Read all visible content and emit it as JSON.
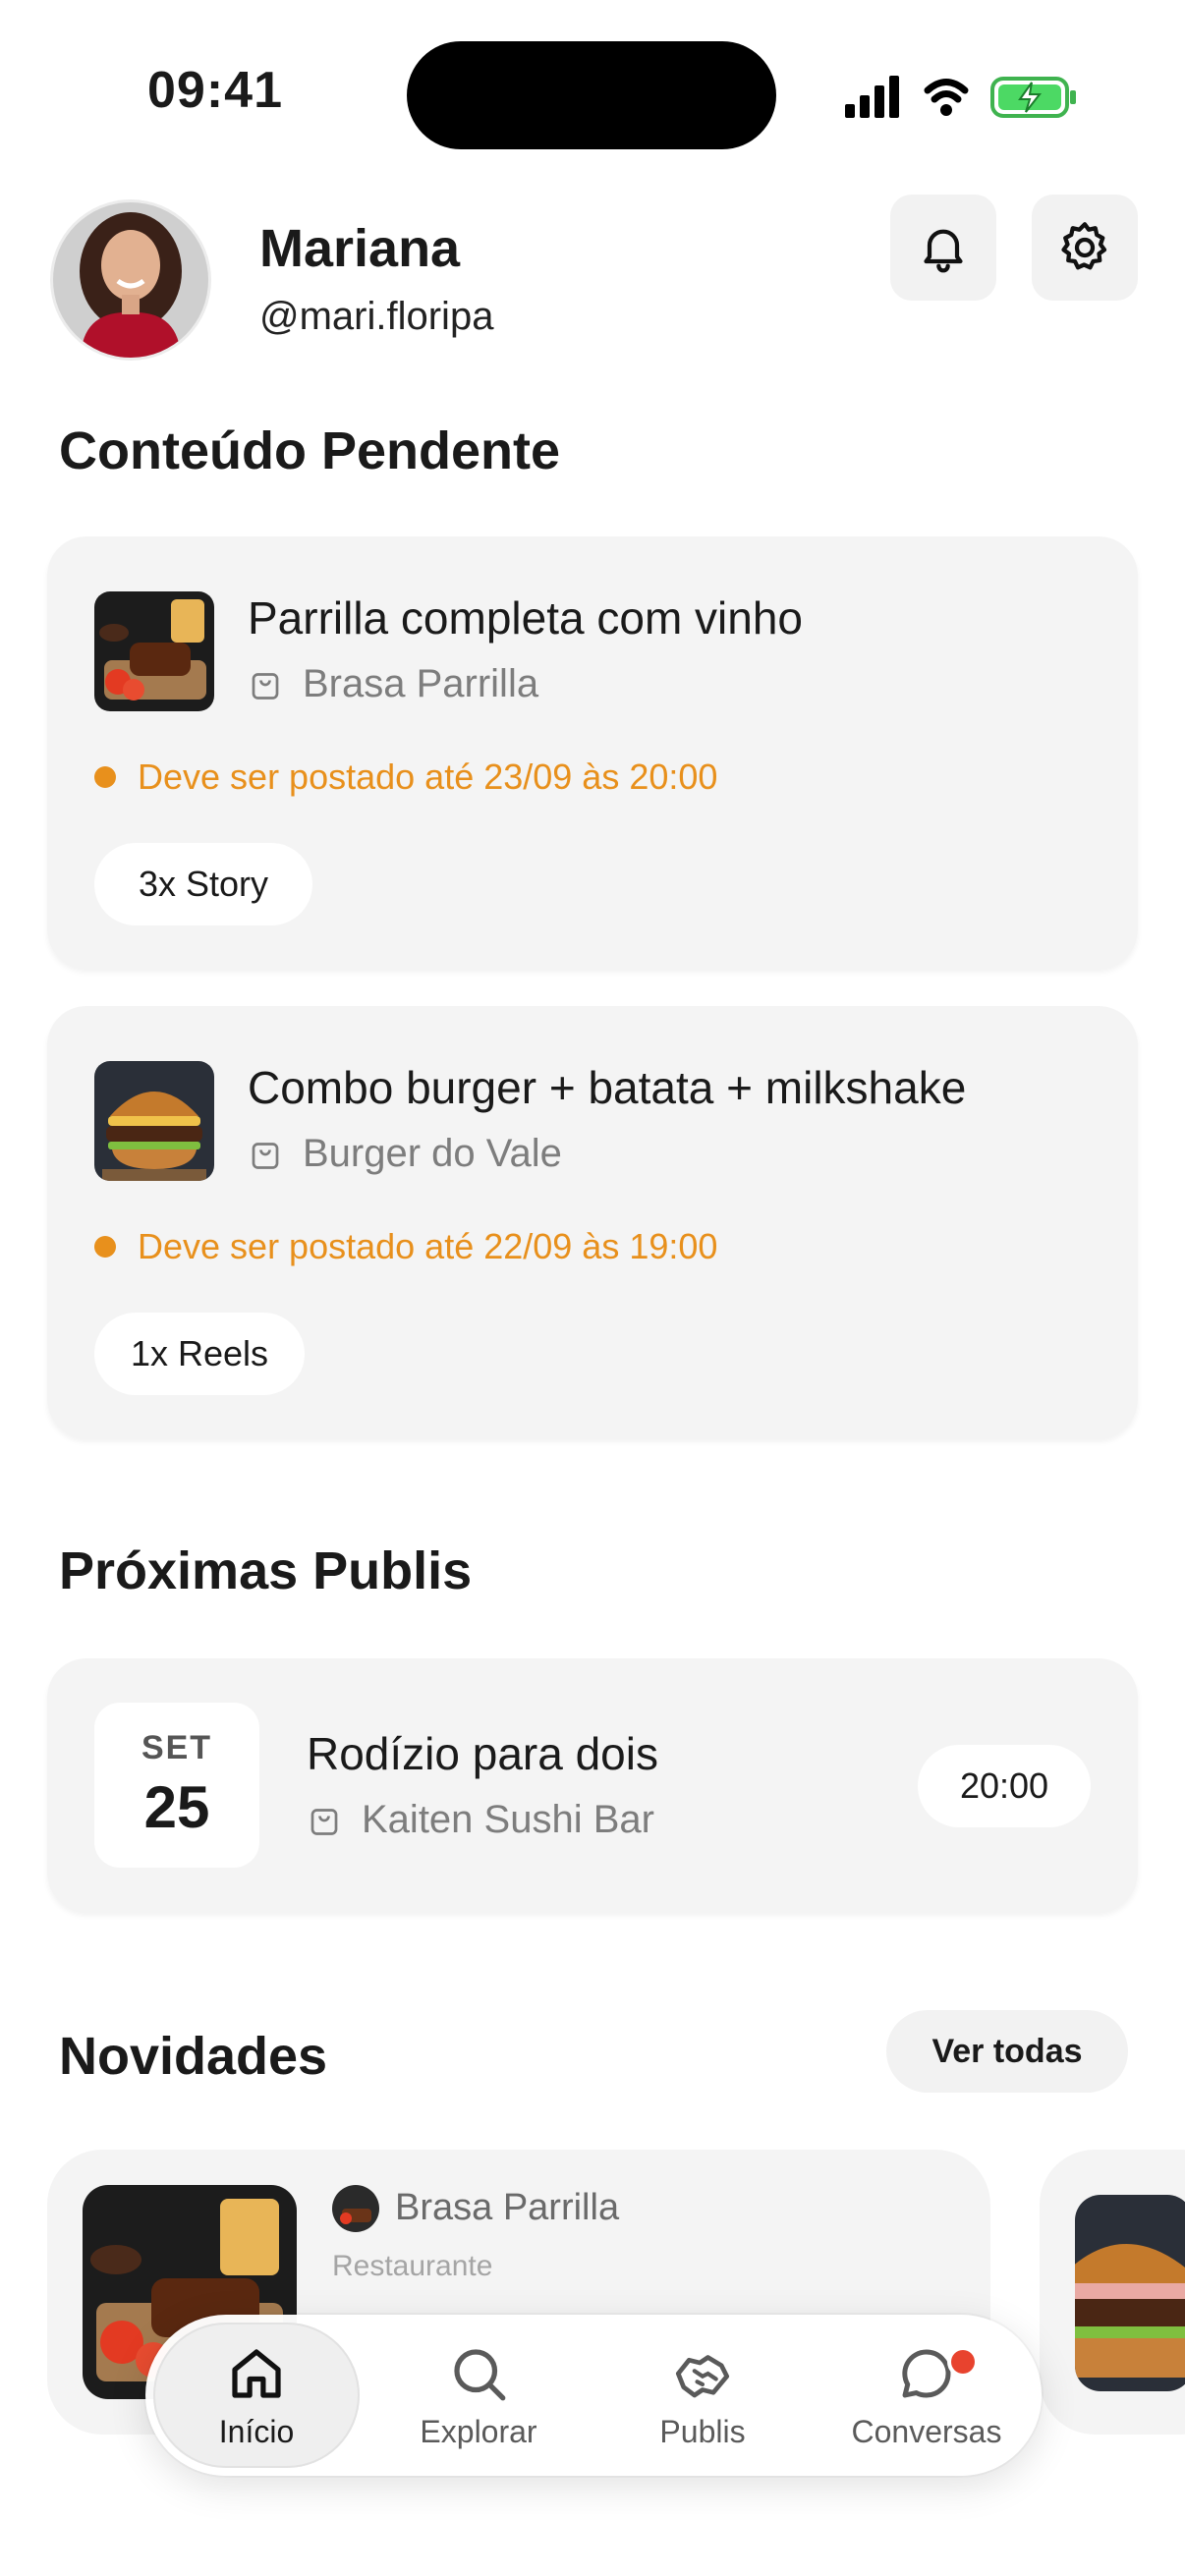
{
  "status_bar": {
    "time": "09:41"
  },
  "profile": {
    "name": "Mariana",
    "handle": "@mari.floripa"
  },
  "pending": {
    "title": "Conteúdo Pendente",
    "items": [
      {
        "title": "Parrilla completa com vinho",
        "store": "Brasa Parrilla",
        "deadline": "Deve ser postado até 23/09 às 20:00",
        "format": "3x Story"
      },
      {
        "title": "Combo burger + batata + milkshake",
        "store": "Burger do Vale",
        "deadline": "Deve ser postado até 22/09 às 19:00",
        "format": "1x Reels"
      }
    ]
  },
  "upcoming": {
    "title": "Próximas Publis",
    "items": [
      {
        "month": "SET",
        "day": "25",
        "title": "Rodízio para dois",
        "store": "Kaiten Sushi Bar",
        "time": "20:00"
      }
    ]
  },
  "news": {
    "title": "Novidades",
    "see_all": "Ver todas",
    "items": [
      {
        "store": "Brasa Parrilla",
        "category": "Restaurante"
      }
    ]
  },
  "nav": {
    "items": [
      {
        "label": "Início",
        "icon": "home-icon"
      },
      {
        "label": "Explorar",
        "icon": "search-icon"
      },
      {
        "label": "Publis",
        "icon": "handshake-icon"
      },
      {
        "label": "Conversas",
        "icon": "chat-icon"
      }
    ]
  },
  "colors": {
    "accent_orange": "#e8901c",
    "badge_red": "#e8432e",
    "card_bg": "#f4f4f4"
  }
}
